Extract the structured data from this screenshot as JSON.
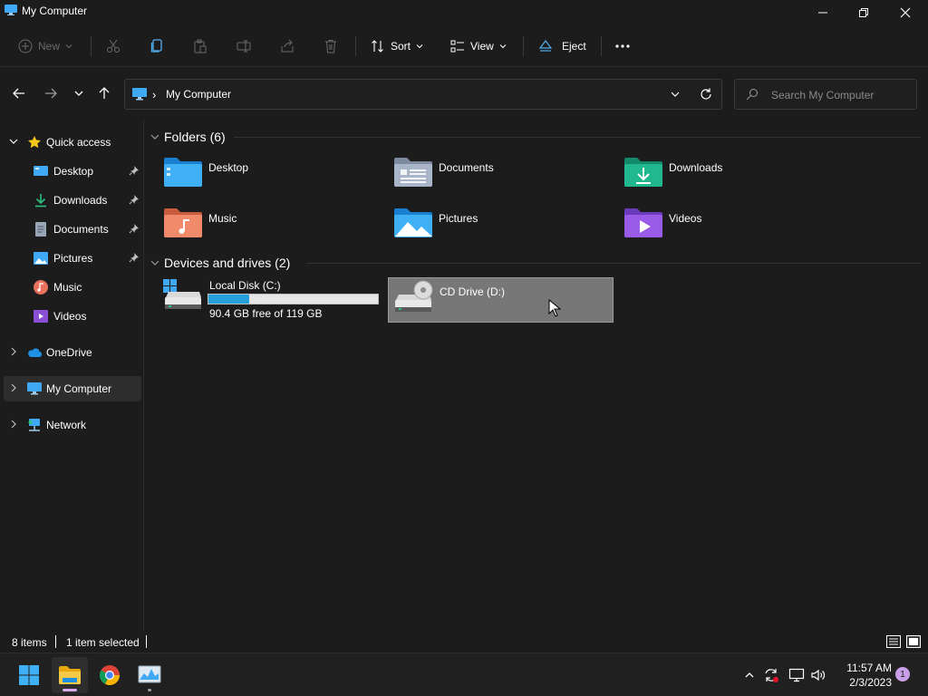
{
  "window": {
    "title": "My Computer",
    "icon": "computer-monitor-icon"
  },
  "titlebar_buttons": [
    "minimize-icon",
    "restore-icon",
    "close-icon"
  ],
  "toolbar": {
    "new_label": "New",
    "sort_label": "Sort",
    "view_label": "View",
    "eject_label": "Eject",
    "icons": [
      "cut-icon",
      "copy-icon",
      "paste-icon",
      "rename-icon",
      "share-icon",
      "delete-icon",
      "more-icon"
    ]
  },
  "address": {
    "path": "My Computer",
    "search_placeholder": "Search My Computer"
  },
  "sidebar": {
    "quick_access": "Quick access",
    "items": [
      {
        "label": "Desktop",
        "icon": "desktop-icon",
        "pinned": true
      },
      {
        "label": "Downloads",
        "icon": "downloads-icon",
        "pinned": true
      },
      {
        "label": "Documents",
        "icon": "documents-icon",
        "pinned": true
      },
      {
        "label": "Pictures",
        "icon": "pictures-icon",
        "pinned": true
      },
      {
        "label": "Music",
        "icon": "music-icon",
        "pinned": false
      },
      {
        "label": "Videos",
        "icon": "videos-icon",
        "pinned": false
      }
    ],
    "onedrive": "OneDrive",
    "my_computer": "My Computer",
    "network": "Network"
  },
  "content": {
    "folders_header": "Folders (6)",
    "folders": [
      {
        "label": "Desktop",
        "icon": "desktop-folder-icon"
      },
      {
        "label": "Documents",
        "icon": "documents-folder-icon"
      },
      {
        "label": "Downloads",
        "icon": "downloads-folder-icon"
      },
      {
        "label": "Music",
        "icon": "music-folder-icon"
      },
      {
        "label": "Pictures",
        "icon": "pictures-folder-icon"
      },
      {
        "label": "Videos",
        "icon": "videos-folder-icon"
      }
    ],
    "drives_header": "Devices and drives (2)",
    "drives": [
      {
        "name": "Local Disk (C:)",
        "free": "90.4 GB free of 119 GB",
        "used_fraction": 0.24
      },
      {
        "name": "CD Drive (D:)",
        "selected": true
      }
    ]
  },
  "status": {
    "items": "8 items",
    "selected": "1 item selected"
  },
  "taskbar": {
    "apps": [
      "windows-start-icon",
      "file-explorer-icon",
      "chrome-icon",
      "task-manager-icon"
    ],
    "time": "11:57 AM",
    "date": "2/3/2023",
    "notifications": "1"
  },
  "colors": {
    "background": "#1c1c1c",
    "accent": "#26a0da",
    "selected_drive": "#777777"
  }
}
